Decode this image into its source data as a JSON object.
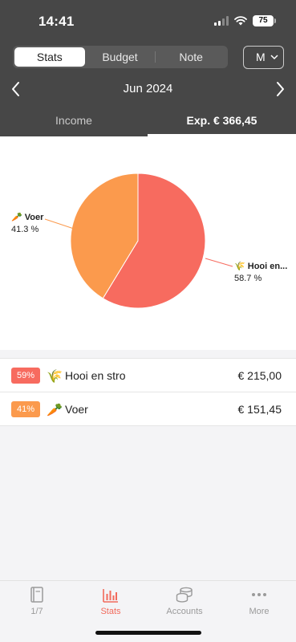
{
  "status": {
    "time": "14:41",
    "battery": "75"
  },
  "segments": [
    {
      "label": "Stats",
      "active": true
    },
    {
      "label": "Budget",
      "active": false
    },
    {
      "label": "Note",
      "active": false
    }
  ],
  "period_select": {
    "value": "M"
  },
  "month": "Jun 2024",
  "tabs": {
    "income": "Income",
    "expense": "Exp. € 366,45"
  },
  "chart_data": {
    "type": "pie",
    "slices": [
      {
        "name": "Hooi en...",
        "value": 58.7,
        "label": "58.7 %",
        "color": "#f76b5f"
      },
      {
        "name": "Voer",
        "value": 41.3,
        "label": "41.3 %",
        "color": "#fb9a4d"
      }
    ]
  },
  "list": [
    {
      "percent": "59%",
      "name": "Hooi en stro",
      "amount": "€ 215,00",
      "color": "#f76b5f",
      "icon": "hay-icon"
    },
    {
      "percent": "41%",
      "name": "Voer",
      "amount": "€ 151,45",
      "color": "#fb9a4d",
      "icon": "carrot-icon"
    }
  ],
  "bottom_nav": [
    {
      "label": "1/7",
      "icon": "book-icon",
      "active": false
    },
    {
      "label": "Stats",
      "icon": "bar-chart-icon",
      "active": true
    },
    {
      "label": "Accounts",
      "icon": "coins-icon",
      "active": false
    },
    {
      "label": "More",
      "icon": "more-dots-icon",
      "active": false
    }
  ]
}
